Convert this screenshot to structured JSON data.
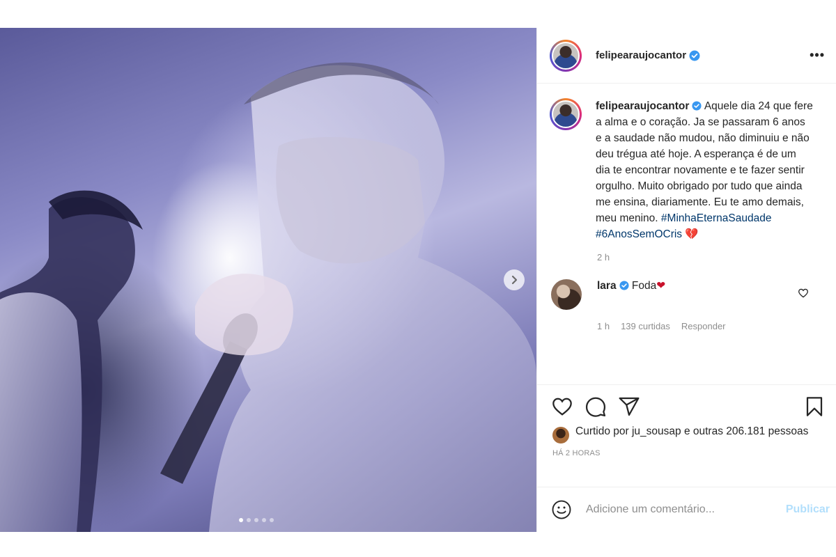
{
  "post": {
    "username": "felipearaujocantor",
    "verified": true,
    "more_label": "•••",
    "carousel": {
      "total": 5,
      "active": 1
    },
    "caption": {
      "username": "felipearaujocantor",
      "text": " Aquele dia 24 que fere a alma e o coração. Ja se passaram 6 anos e a saudade não mudou, não diminuiu e não deu trégua até hoje. A esperança é de um dia te encontrar novamente e te fazer sentir orgulho. Muito obrigado por tudo que ainda me ensina, diariamente. Eu te amo demais, meu menino. ",
      "hashtag1": "#MinhaEternaSaudade",
      "hashtag2": "#6AnosSemOCris",
      "emoji": "💔",
      "time": "2 h"
    },
    "reply": {
      "username": "lara",
      "text": " Foda",
      "emoji": "❤",
      "time": "1 h",
      "likes": "139 curtidas",
      "reply_label": "Responder"
    },
    "likes_text": "Curtido por ju_sousap e outras 206.181 pessoas",
    "posted_ago": "HÁ 2 HORAS",
    "comment_box": {
      "placeholder": "Adicione um comentário...",
      "publish_label": "Publicar"
    }
  },
  "colors": {
    "verified": "#3897f0",
    "hashtag": "#00376b",
    "publish_disabled": "#b2dffc",
    "muted": "#8e8e8e",
    "broken_heart": "#c9112b"
  }
}
